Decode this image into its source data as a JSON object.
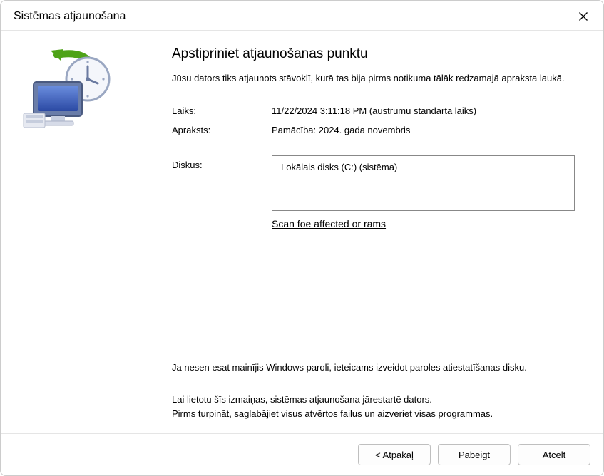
{
  "titlebar": {
    "title": "Sistēmas atjaunošana"
  },
  "main": {
    "heading": "Apstipriniet atjaunošanas punktu",
    "subtext": "Jūsu dators tiks atjaunots stāvoklī, kurā tas bija pirms notikuma tālāk redzamajā apraksta laukā.",
    "time_label": "Laiks:",
    "time_value": "11/22/2024 3:11:18 PM (austrumu standarta laiks)",
    "desc_label": "Apraksts:",
    "desc_value": "Pamācība: 2024. gada novembris",
    "drives_label": "Diskus:",
    "drives_value": "Lokālais disks (C:) (sistēma)",
    "scan_link": "Scan foe affected or rams",
    "note1": "Ja nesen esat mainījis Windows paroli, ieteicams izveidot paroles atiestatīšanas disku.",
    "note2a": "Lai lietotu šīs izmaiņas, sistēmas atjaunošana jārestartē dators.",
    "note2b": "Pirms turpināt, saglabājiet visus atvērtos failus un aizveriet visas programmas."
  },
  "footer": {
    "back": "< Atpakaļ",
    "finish": "Pabeigt",
    "cancel": "Atcelt"
  }
}
